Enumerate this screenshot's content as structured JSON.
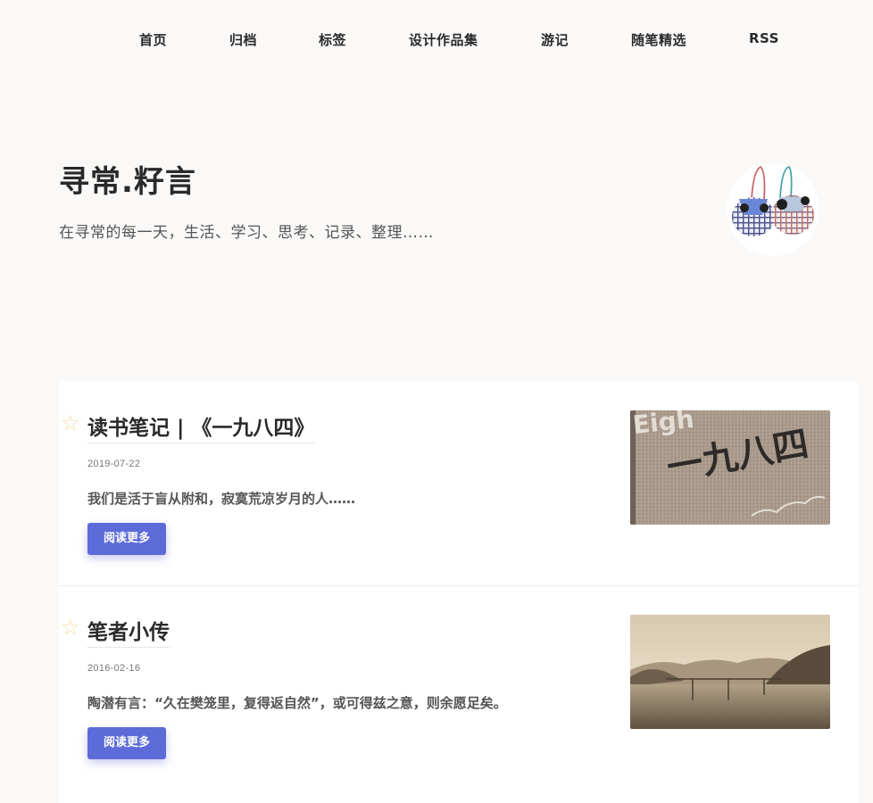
{
  "nav": {
    "items": [
      {
        "label": "首页"
      },
      {
        "label": "归档"
      },
      {
        "label": "标签"
      },
      {
        "label": "设计作品集"
      },
      {
        "label": "游记"
      },
      {
        "label": "随笔精选"
      },
      {
        "label": "RSS"
      }
    ]
  },
  "hero": {
    "title": "寻常.籽言",
    "subtitle": "在寻常的每一天，生活、学习、思考、记录、整理……"
  },
  "posts": [
    {
      "title": "读书笔记 | 《一九八四》",
      "date": "2019-07-22",
      "excerpt": "我们是活于盲从附和，寂寞荒凉岁月的人……",
      "button": "阅读更多",
      "thumb_text": "一九八四"
    },
    {
      "title": "笔者小传",
      "date": "2016-02-16",
      "excerpt": "陶潜有言：“久在樊笼里，复得返自然”，或可得兹之意，则余愿足矣。",
      "button": "阅读更多"
    }
  ],
  "colors": {
    "background": "#faf9f7",
    "card": "#ffffff",
    "button": "#5c6bd8",
    "star": "#f3dca0"
  }
}
